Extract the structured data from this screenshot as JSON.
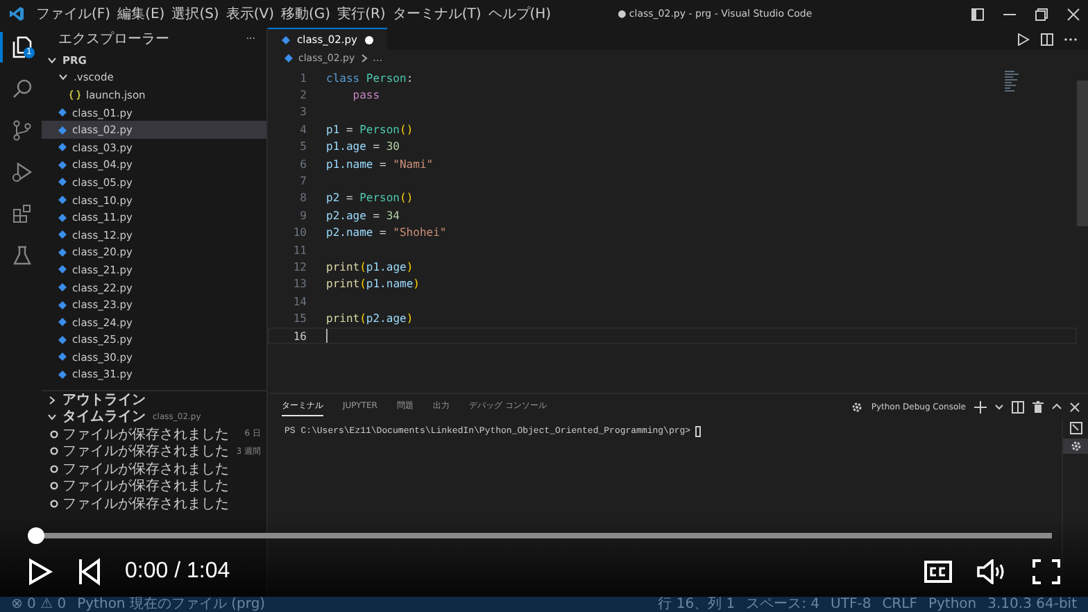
{
  "window": {
    "title": "● class_02.py - prg - Visual Studio Code",
    "menu": [
      "ファイル(F)",
      "編集(E)",
      "選択(S)",
      "表示(V)",
      "移動(G)",
      "実行(R)",
      "ターミナル(T)",
      "ヘルプ(H)"
    ]
  },
  "activity_bar": {
    "items": [
      {
        "kind": "explorer",
        "selected": true,
        "badge": "1"
      },
      {
        "kind": "search",
        "selected": false
      },
      {
        "kind": "source-control",
        "selected": false
      },
      {
        "kind": "run",
        "selected": false
      },
      {
        "kind": "extensions",
        "selected": false
      },
      {
        "kind": "testing",
        "selected": false
      }
    ]
  },
  "sidebar": {
    "title": "エクスプローラー",
    "more": "···",
    "tree": {
      "label": "PRG",
      "kind": "folder",
      "expanded": true,
      "selected": false,
      "children": [
        {
          "label": ".vscode",
          "kind": "folder",
          "expanded": true,
          "selected": false,
          "children": [
            {
              "label": "launch.json",
              "kind": "json",
              "selected": false
            }
          ]
        },
        {
          "label": "class_01.py",
          "kind": "python",
          "selected": false
        },
        {
          "label": "class_02.py",
          "kind": "python",
          "selected": true
        },
        {
          "label": "class_03.py",
          "kind": "python",
          "selected": false
        },
        {
          "label": "class_04.py",
          "kind": "python",
          "selected": false
        },
        {
          "label": "class_05.py",
          "kind": "python",
          "selected": false
        },
        {
          "label": "class_10.py",
          "kind": "python",
          "selected": false
        },
        {
          "label": "class_11.py",
          "kind": "python",
          "selected": false
        },
        {
          "label": "class_12.py",
          "kind": "python",
          "selected": false
        },
        {
          "label": "class_20.py",
          "kind": "python",
          "selected": false
        },
        {
          "label": "class_21.py",
          "kind": "python",
          "selected": false
        },
        {
          "label": "class_22.py",
          "kind": "python",
          "selected": false
        },
        {
          "label": "class_23.py",
          "kind": "python",
          "selected": false
        },
        {
          "label": "class_24.py",
          "kind": "python",
          "selected": false
        },
        {
          "label": "class_25.py",
          "kind": "python",
          "selected": false
        },
        {
          "label": "class_30.py",
          "kind": "python",
          "selected": false
        },
        {
          "label": "class_31.py",
          "kind": "python",
          "selected": false
        }
      ]
    },
    "outline": {
      "label": "アウトライン",
      "expanded": false
    },
    "timeline": {
      "label": "タイムライン",
      "expanded": true,
      "file": "class_02.py",
      "entries": [
        {
          "label": "ファイルが保存されました",
          "time": "6 日"
        },
        {
          "label": "ファイルが保存されました",
          "time": "3 週間"
        },
        {
          "label": "ファイルが保存されました"
        },
        {
          "label": "ファイルが保存されました"
        },
        {
          "label": "ファイルが保存されました"
        }
      ]
    }
  },
  "editor": {
    "tabs": [
      {
        "label": "class_02.py",
        "modified": true,
        "selected": true
      }
    ],
    "breadcrumb": [
      "class_02.py",
      "…"
    ],
    "lines": [
      {
        "number": "1",
        "current": false,
        "tokens": [
          {
            "kind": "keyword",
            "text": "class "
          },
          {
            "kind": "class",
            "text": "Person"
          },
          {
            "kind": "op",
            "text": ":"
          }
        ]
      },
      {
        "number": "2",
        "current": false,
        "tokens": [
          {
            "kind": "control",
            "text": "    pass"
          }
        ]
      },
      {
        "number": "3",
        "current": false
      },
      {
        "number": "4",
        "current": false,
        "tokens": [
          {
            "kind": "var",
            "text": "p1"
          },
          {
            "kind": "op",
            "text": " = "
          },
          {
            "kind": "class",
            "text": "Person"
          },
          {
            "kind": "paren",
            "text": "()"
          }
        ]
      },
      {
        "number": "5",
        "current": false,
        "tokens": [
          {
            "kind": "var",
            "text": "p1.age"
          },
          {
            "kind": "op",
            "text": " = "
          },
          {
            "kind": "number",
            "text": "30"
          }
        ]
      },
      {
        "number": "6",
        "current": false,
        "tokens": [
          {
            "kind": "var",
            "text": "p1.name"
          },
          {
            "kind": "op",
            "text": " = "
          },
          {
            "kind": "string",
            "text": "\"Nami\""
          }
        ]
      },
      {
        "number": "7",
        "current": false
      },
      {
        "number": "8",
        "current": false,
        "tokens": [
          {
            "kind": "var",
            "text": "p2"
          },
          {
            "kind": "op",
            "text": " = "
          },
          {
            "kind": "class",
            "text": "Person"
          },
          {
            "kind": "paren",
            "text": "()"
          }
        ]
      },
      {
        "number": "9",
        "current": false,
        "tokens": [
          {
            "kind": "var",
            "text": "p2.age"
          },
          {
            "kind": "op",
            "text": " = "
          },
          {
            "kind": "number",
            "text": "34"
          }
        ]
      },
      {
        "number": "10",
        "current": false,
        "tokens": [
          {
            "kind": "var",
            "text": "p2.name"
          },
          {
            "kind": "op",
            "text": " = "
          },
          {
            "kind": "string",
            "text": "\"Shohei\""
          }
        ]
      },
      {
        "number": "11",
        "current": false
      },
      {
        "number": "12",
        "current": false,
        "tokens": [
          {
            "kind": "function",
            "text": "print"
          },
          {
            "kind": "paren",
            "text": "("
          },
          {
            "kind": "var",
            "text": "p1.age"
          },
          {
            "kind": "paren",
            "text": ")"
          }
        ]
      },
      {
        "number": "13",
        "current": false,
        "tokens": [
          {
            "kind": "function",
            "text": "print"
          },
          {
            "kind": "paren",
            "text": "("
          },
          {
            "kind": "var",
            "text": "p1.name"
          },
          {
            "kind": "paren",
            "text": ")"
          }
        ]
      },
      {
        "number": "14",
        "current": false
      },
      {
        "number": "15",
        "current": false,
        "tokens": [
          {
            "kind": "function",
            "text": "print"
          },
          {
            "kind": "paren",
            "text": "("
          },
          {
            "kind": "var",
            "text": "p2.age"
          },
          {
            "kind": "paren",
            "text": ")"
          }
        ]
      },
      {
        "number": "16",
        "current": true
      }
    ]
  },
  "panel": {
    "tabs": [
      {
        "label": "ターミナル",
        "selected": true
      },
      {
        "label": "JUPYTER",
        "selected": false
      },
      {
        "label": "問題",
        "selected": false
      },
      {
        "label": "出力",
        "selected": false
      },
      {
        "label": "デバッグ コンソール",
        "selected": false
      }
    ],
    "terminal_name": "Python Debug Console",
    "prompt": "PS C:\\Users\\Ez11\\Documents\\LinkedIn\\Python_Object_Oriented_Programming\\prg> "
  },
  "status_bar": {
    "left": [
      "⊗ 0  ⚠ 0",
      "Python 現在のファイル (prg)"
    ],
    "right": [
      "行 16、列 1",
      "スペース: 4",
      "UTF-8",
      "CRLF",
      "Python",
      "3.10.3 64-bit"
    ]
  },
  "video": {
    "level": 0,
    "time": "0:00 / 1:04"
  }
}
